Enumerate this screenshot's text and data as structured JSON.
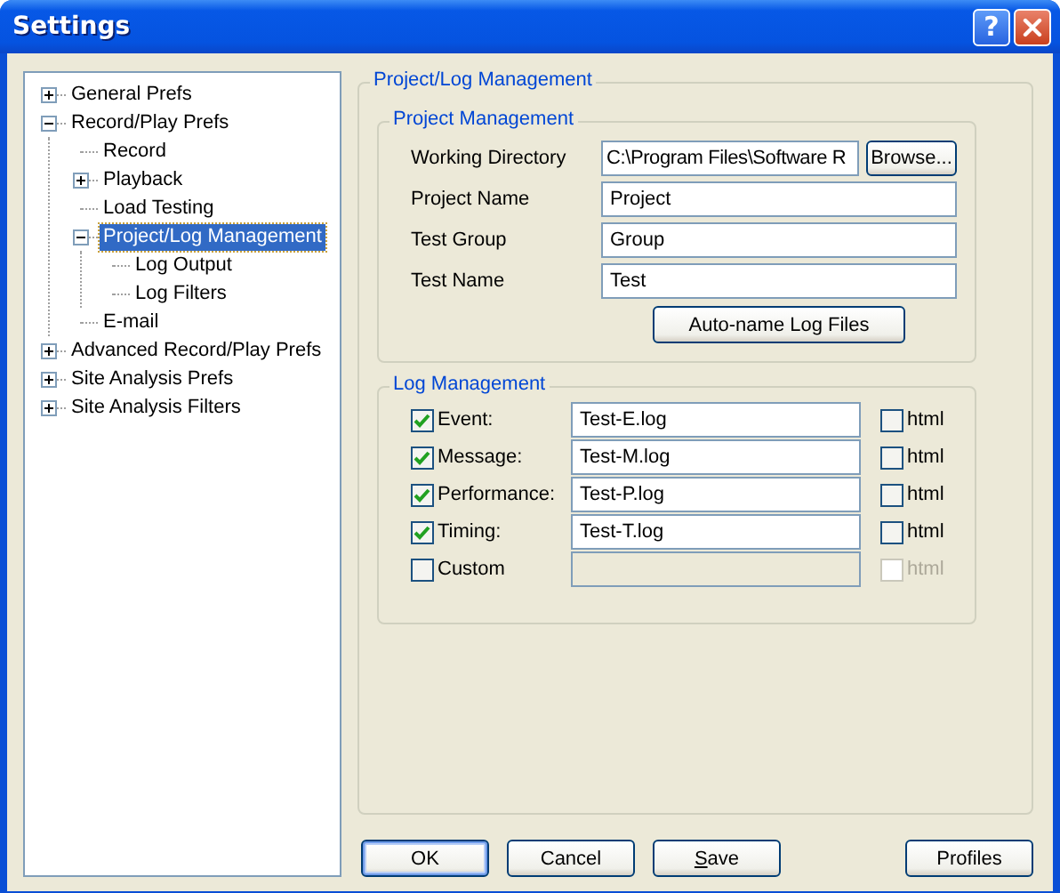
{
  "window": {
    "title": "Settings",
    "title_buttons": [
      {
        "kind": "help",
        "label": "?"
      },
      {
        "kind": "close"
      }
    ]
  },
  "tree": [
    {
      "label": "General Prefs",
      "expanded": false,
      "selected": false
    },
    {
      "label": "Record/Play Prefs",
      "expanded": true,
      "selected": false,
      "children": [
        {
          "label": "Record",
          "selected": false
        },
        {
          "label": "Playback",
          "expanded": false,
          "selected": false
        },
        {
          "label": "Load Testing",
          "selected": false
        },
        {
          "label": "Project/Log Management",
          "expanded": true,
          "selected": true,
          "children": [
            {
              "label": "Log Output",
              "selected": false
            },
            {
              "label": "Log Filters",
              "selected": false
            }
          ]
        },
        {
          "label": "E-mail",
          "selected": false
        }
      ]
    },
    {
      "label": "Advanced Record/Play Prefs",
      "expanded": false,
      "selected": false
    },
    {
      "label": "Site Analysis Prefs",
      "expanded": false,
      "selected": false
    },
    {
      "label": "Site Analysis Filters",
      "expanded": false,
      "selected": false
    }
  ],
  "panel": {
    "title": "Project/Log Management",
    "project": {
      "title": "Project Management",
      "fields": [
        {
          "label": "Working Directory",
          "value": "C:\\Program Files\\Software R",
          "button": "Browse..."
        },
        {
          "label": "Project Name",
          "value": "Project"
        },
        {
          "label": "Test Group",
          "value": "Group"
        },
        {
          "label": "Test Name",
          "value": "Test"
        }
      ],
      "action": "Auto-name Log Files"
    },
    "log": {
      "title": "Log Management",
      "rows": [
        {
          "label": "Event:",
          "checked": true,
          "value": "Test-E.log",
          "html_label": "html",
          "html_checked": false,
          "disabled": false
        },
        {
          "label": "Message:",
          "checked": true,
          "value": "Test-M.log",
          "html_label": "html",
          "html_checked": false,
          "disabled": false
        },
        {
          "label": "Performance:",
          "checked": true,
          "value": "Test-P.log",
          "html_label": "html",
          "html_checked": false,
          "disabled": false
        },
        {
          "label": "Timing:",
          "checked": true,
          "value": "Test-T.log",
          "html_label": "html",
          "html_checked": false,
          "disabled": false
        },
        {
          "label": "Custom",
          "checked": false,
          "html_label": "html",
          "html_checked": false,
          "disabled": true
        }
      ]
    }
  },
  "buttons": [
    {
      "label": "OK",
      "default": true,
      "mnemonic": false
    },
    {
      "label": "Cancel",
      "default": false,
      "mnemonic": false
    },
    {
      "label": "Save",
      "default": false,
      "mnemonic": true
    },
    {
      "label": "Profiles",
      "default": false,
      "mnemonic": false,
      "kind": "right"
    }
  ]
}
